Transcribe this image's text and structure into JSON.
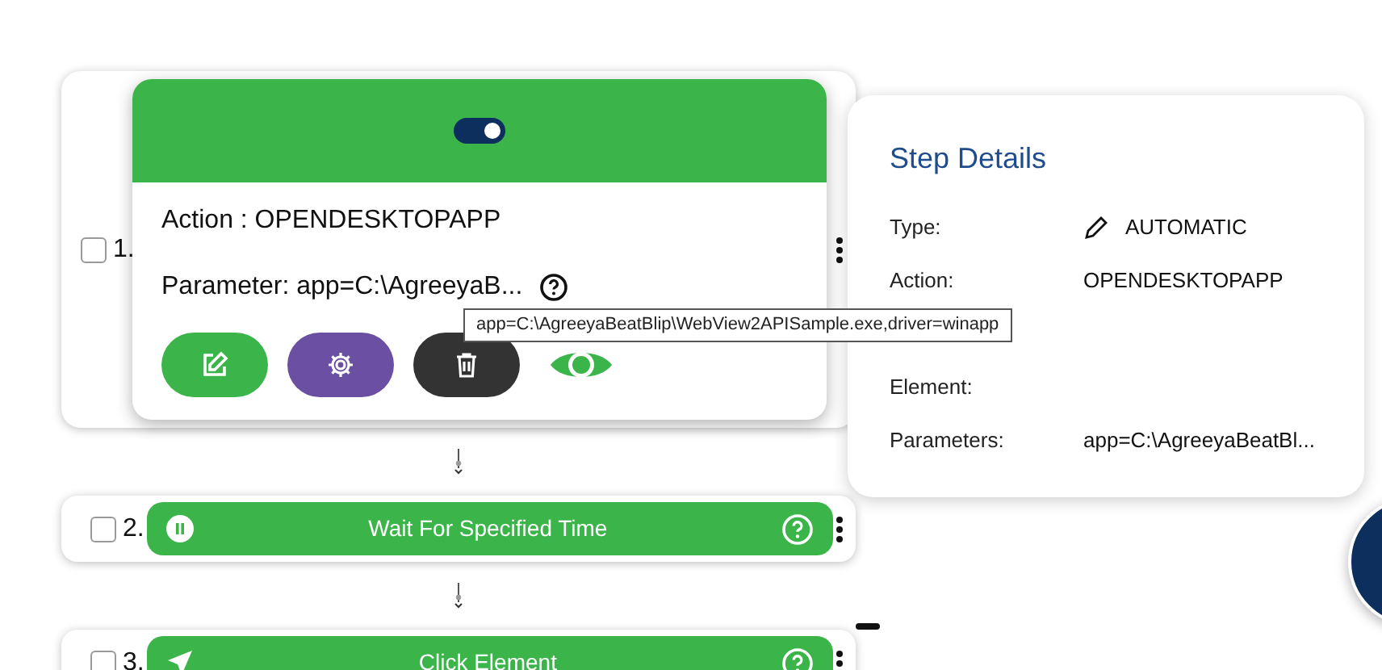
{
  "steps": [
    {
      "number": "1.",
      "checked": false,
      "kind": "expanded",
      "toggle_on": true,
      "action_text": "Action : OPENDESKTOPAPP",
      "parameter_text": "Parameter: app=C:\\AgreeyaB..."
    },
    {
      "number": "2.",
      "checked": false,
      "kind": "wait",
      "title": "Wait For Specified Time"
    },
    {
      "number": "3.",
      "checked": false,
      "kind": "click",
      "title": "Click Element"
    }
  ],
  "tooltip": "app=C:\\AgreeyaBeatBlip\\WebView2APISample.exe,driver=winapp",
  "step_details": {
    "title": "Step Details",
    "fields": [
      {
        "label": "Type:",
        "value": "AUTOMATIC",
        "kind": "type"
      },
      {
        "label": "Action:",
        "value": "OPENDESKTOPAPP",
        "kind": "text"
      },
      {
        "label": "Element:",
        "kind": "text"
      },
      {
        "label": "Parameters:",
        "value": "app=C:\\AgreeyaBeatBl...",
        "kind": "text"
      }
    ]
  }
}
